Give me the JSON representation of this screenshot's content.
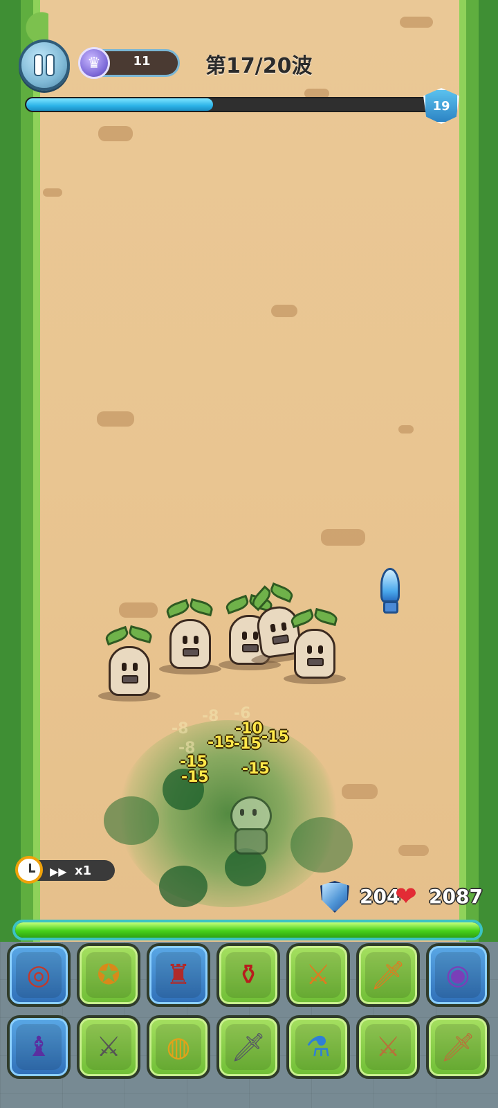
{
  "hud": {
    "crown_count": "11",
    "wave_label": "第17/20波",
    "wave_progress": 0.46,
    "level_badge": "19"
  },
  "speed": {
    "multiplier": "x1"
  },
  "stats": {
    "shield": "204",
    "hp": "2087",
    "hp_fill": 1.0
  },
  "damage_numbers": [
    {
      "text": "-15",
      "faint": false
    },
    {
      "text": "-15",
      "faint": false
    },
    {
      "text": "-15",
      "faint": false
    },
    {
      "text": "-15",
      "faint": false
    },
    {
      "text": "-15",
      "faint": false
    },
    {
      "text": "-10",
      "faint": false
    },
    {
      "text": "-15",
      "faint": false
    },
    {
      "text": "-8",
      "faint": true
    },
    {
      "text": "-8",
      "faint": true
    },
    {
      "text": "-6",
      "faint": true
    },
    {
      "text": "-8",
      "faint": true
    }
  ],
  "inventory": {
    "row1": [
      {
        "icon": "round-shield-icon",
        "tier": "blue"
      },
      {
        "icon": "gold-amulet-icon",
        "tier": "green"
      },
      {
        "icon": "red-robe-icon",
        "tier": "blue"
      },
      {
        "icon": "red-potion-icon",
        "tier": "green"
      },
      {
        "icon": "orange-sword-icon",
        "tier": "green"
      },
      {
        "icon": "orange-dagger-icon",
        "tier": "green"
      },
      {
        "icon": "purple-shield-icon",
        "tier": "blue"
      }
    ],
    "row2": [
      {
        "icon": "purple-cloak-icon",
        "tier": "blue"
      },
      {
        "icon": "iron-sword-icon",
        "tier": "green"
      },
      {
        "icon": "gold-ring-icon",
        "tier": "green"
      },
      {
        "icon": "steel-dagger-icon",
        "tier": "green"
      },
      {
        "icon": "blue-potion-icon",
        "tier": "green"
      },
      {
        "icon": "wooden-sword-icon",
        "tier": "green"
      },
      {
        "icon": "bronze-dagger-icon",
        "tier": "green"
      }
    ]
  }
}
